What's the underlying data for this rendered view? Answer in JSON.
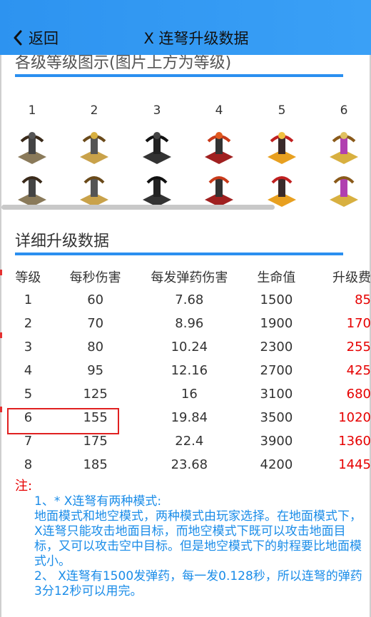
{
  "header": {
    "back_label": "返回",
    "title": "X 连弩升级数据"
  },
  "section1": {
    "title": "各级等级图示(图片上方为等级)",
    "levels": [
      "1",
      "2",
      "3",
      "4",
      "5",
      "6"
    ]
  },
  "section2": {
    "title": "详细升级数据",
    "columns": [
      "等级",
      "每秒伤害",
      "每发弹药伤害",
      "生命值",
      "升级费"
    ],
    "rows": [
      {
        "level": "1",
        "dps": "60",
        "dmg": "7.68",
        "hp": "1500",
        "cost": "85"
      },
      {
        "level": "2",
        "dps": "70",
        "dmg": "8.96",
        "hp": "1900",
        "cost": "170"
      },
      {
        "level": "3",
        "dps": "80",
        "dmg": "10.24",
        "hp": "2300",
        "cost": "255"
      },
      {
        "level": "4",
        "dps": "95",
        "dmg": "12.16",
        "hp": "2700",
        "cost": "425"
      },
      {
        "level": "5",
        "dps": "125",
        "dmg": "16",
        "hp": "3100",
        "cost": "680"
      },
      {
        "level": "6",
        "dps": "155",
        "dmg": "19.84",
        "hp": "3500",
        "cost": "1020"
      },
      {
        "level": "7",
        "dps": "175",
        "dmg": "22.4",
        "hp": "3900",
        "cost": "1360"
      },
      {
        "level": "8",
        "dps": "185",
        "dmg": "23.68",
        "hp": "4200",
        "cost": "1445"
      }
    ]
  },
  "notes": {
    "label": "注:",
    "lines": [
      "1、* X连弩有两种模式:",
      "地面模式和地空模式，两种模式由玩家选择。在地面模式下，X连弩只能攻击地面目标，而地空模式下既可以攻击地面目标，又可以攻击空中目标。但是地空模式下的射程要比地面模式小。",
      "2、 X连弩有1500发弹药，每一发0.128秒，所以连弩的弹药3分12秒可以用完。"
    ]
  },
  "colors": {
    "header": "#3aa0f6",
    "accent_line": "#2a8ff0",
    "cost": "#e60000",
    "note": "#1a8ce8"
  }
}
